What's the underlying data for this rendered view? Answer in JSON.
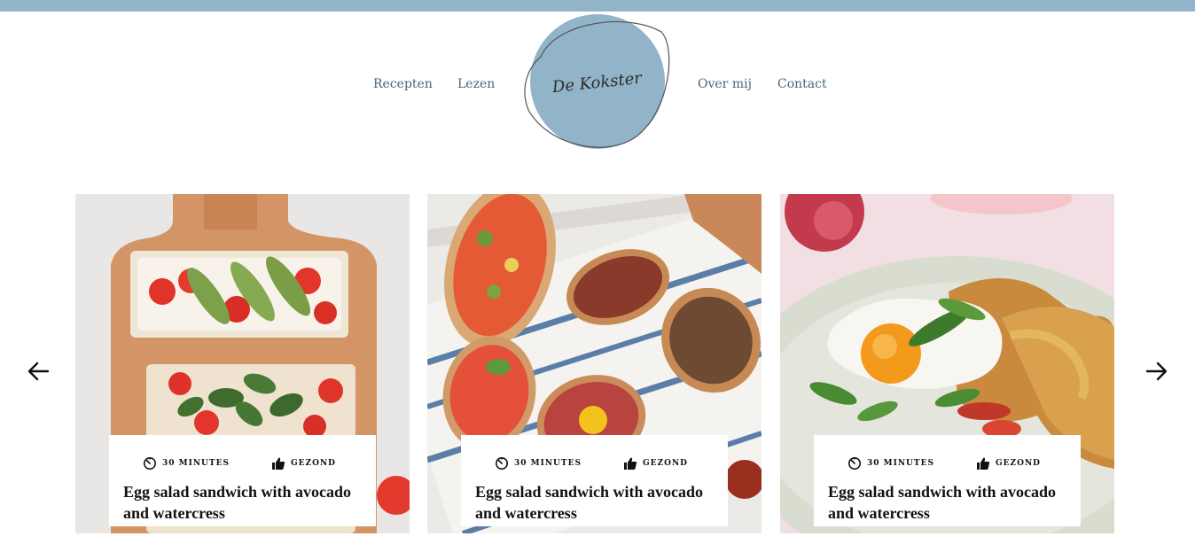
{
  "colors": {
    "accent": "#92b4c9",
    "nav_text": "#4a6577"
  },
  "logo": {
    "text": "De Kokster"
  },
  "nav": {
    "left": [
      {
        "label": "Recepten"
      },
      {
        "label": "Lezen"
      }
    ],
    "right": [
      {
        "label": "Over mij"
      },
      {
        "label": "Contact"
      }
    ]
  },
  "carousel": {
    "prev_icon": "arrow-left-icon",
    "next_icon": "arrow-right-icon",
    "cards": [
      {
        "time_label": "30 MINUTES",
        "health_label": "GEZOND",
        "title": "Egg salad sandwich with avocado and watercress"
      },
      {
        "time_label": "30 MINUTES",
        "health_label": "GEZOND",
        "title": "Egg salad sandwich with avocado and watercress"
      },
      {
        "time_label": "30 MINUTES",
        "health_label": "GEZOND",
        "title": "Egg salad sandwich with avocado and watercress"
      }
    ]
  }
}
